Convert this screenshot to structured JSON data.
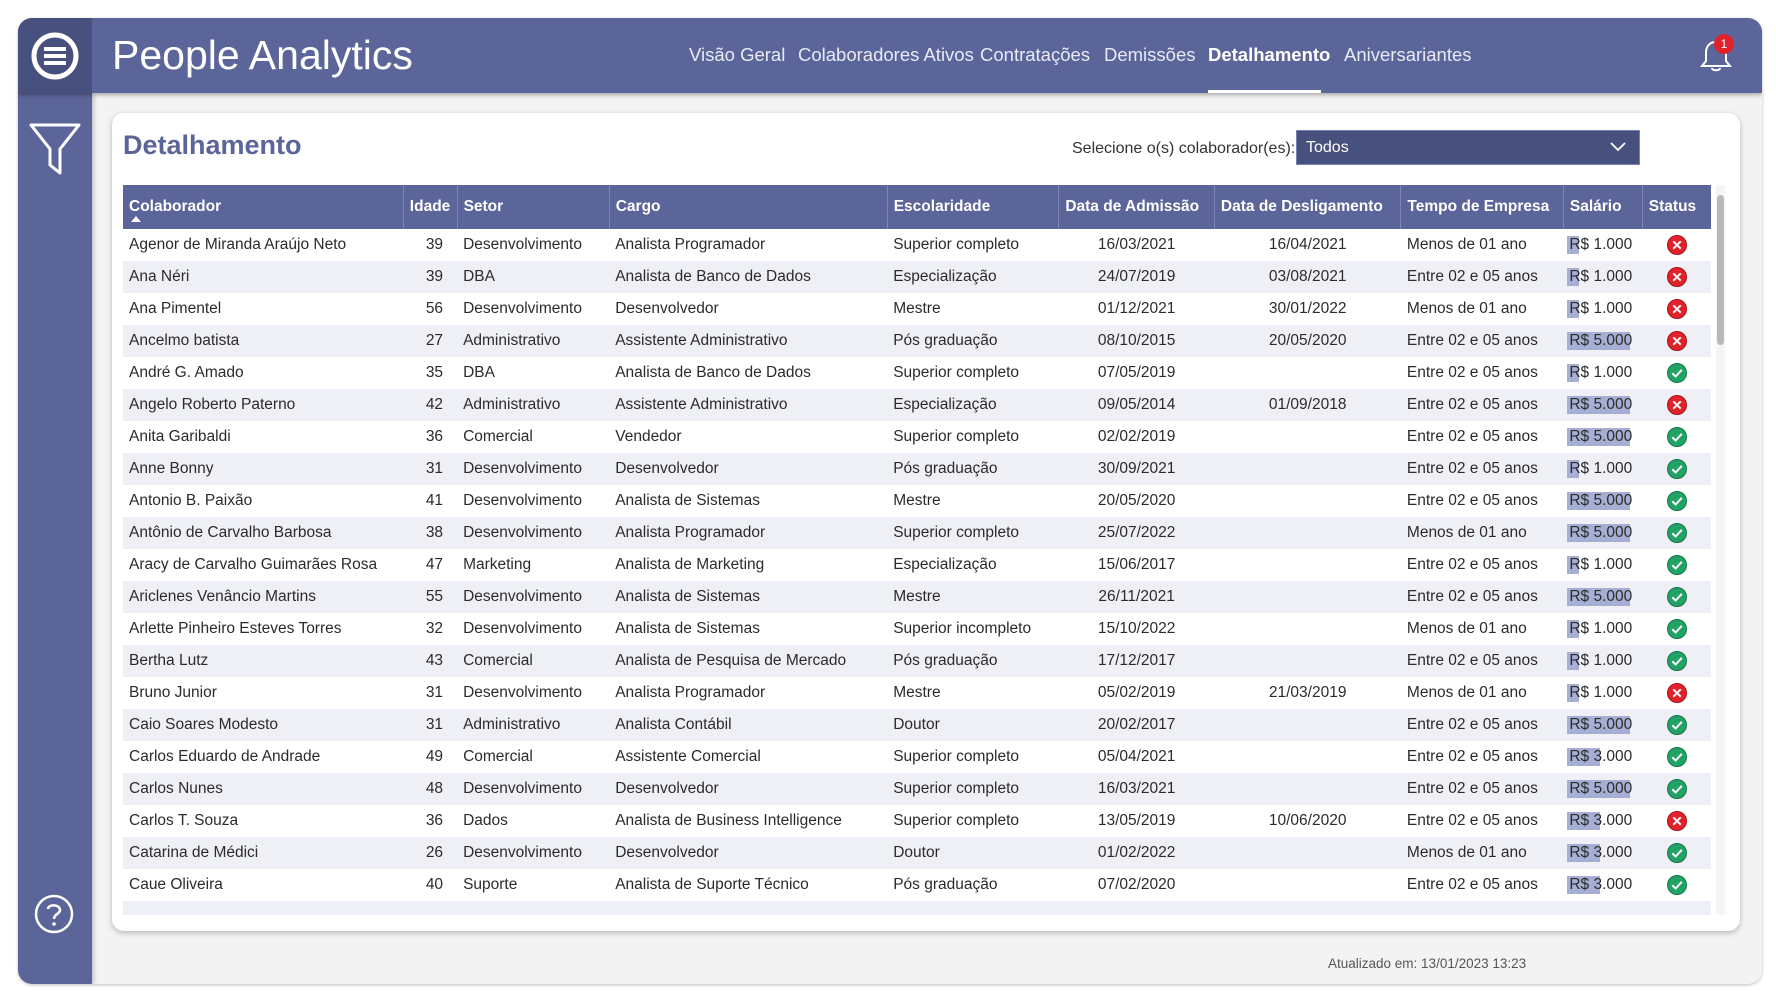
{
  "app": {
    "title": "People Analytics",
    "logo_icon": "hamburger-circle-logo"
  },
  "nav": {
    "items": [
      {
        "label": "Visão Geral",
        "active": false
      },
      {
        "label": "Colaboradores Ativos",
        "active": false
      },
      {
        "label": "Contratações",
        "active": false
      },
      {
        "label": "Demissões",
        "active": false
      },
      {
        "label": "Detalhamento",
        "active": true
      },
      {
        "label": "Aniversariantes",
        "active": false
      }
    ],
    "notifications": {
      "icon": "bell-icon",
      "count": "1"
    }
  },
  "sidebar": {
    "filter_icon": "filter-icon",
    "help_icon": "help-icon"
  },
  "page": {
    "title": "Detalhamento",
    "selector_label": "Selecione o(s) colaborador(es):",
    "selector_value": "Todos"
  },
  "table": {
    "columns": [
      "Colaborador",
      "Idade",
      "Setor",
      "Cargo",
      "Escolaridade",
      "Data de Admissão",
      "Data de Desligamento",
      "Tempo de Empresa",
      "Salário",
      "Status"
    ],
    "rows": [
      {
        "name": "Agenor de Miranda Araújo Neto",
        "age": "39",
        "sector": "Desenvolvimento",
        "role": "Analista Programador",
        "education": "Superior completo",
        "admission": "16/03/2021",
        "termination": "16/04/2021",
        "tenure": "Menos de 01 ano",
        "salary": "R$ 1.000",
        "salary_fraction": 0.04,
        "status": "desligado"
      },
      {
        "name": "Ana Néri",
        "age": "39",
        "sector": "DBA",
        "role": "Analista de Banco de Dados",
        "education": "Especialização",
        "admission": "24/07/2019",
        "termination": "03/08/2021",
        "tenure": "Entre 02 e 05 anos",
        "salary": "R$ 1.000",
        "salary_fraction": 0.04,
        "status": "desligado"
      },
      {
        "name": "Ana Pimentel",
        "age": "56",
        "sector": "Desenvolvimento",
        "role": "Desenvolvedor",
        "education": "Mestre",
        "admission": "01/12/2021",
        "termination": "30/01/2022",
        "tenure": "Menos de 01 ano",
        "salary": "R$ 1.000",
        "salary_fraction": 0.04,
        "status": "desligado"
      },
      {
        "name": "Ancelmo batista",
        "age": "27",
        "sector": "Administrativo",
        "role": "Assistente Administrativo",
        "education": "Pós graduação",
        "admission": "08/10/2015",
        "termination": "20/05/2020",
        "tenure": "Entre 02 e 05 anos",
        "salary": "R$ 5.000",
        "salary_fraction": 1.0,
        "status": "desligado"
      },
      {
        "name": "André G. Amado",
        "age": "35",
        "sector": "DBA",
        "role": "Analista de Banco de Dados",
        "education": "Superior completo",
        "admission": "07/05/2019",
        "termination": "",
        "tenure": "Entre 02 e 05 anos",
        "salary": "R$ 1.000",
        "salary_fraction": 0.04,
        "status": "ativo"
      },
      {
        "name": "Angelo Roberto Paterno",
        "age": "42",
        "sector": "Administrativo",
        "role": "Assistente Administrativo",
        "education": "Especialização",
        "admission": "09/05/2014",
        "termination": "01/09/2018",
        "tenure": "Entre 02 e 05 anos",
        "salary": "R$ 5.000",
        "salary_fraction": 1.0,
        "status": "desligado"
      },
      {
        "name": "Anita Garibaldi",
        "age": "36",
        "sector": "Comercial",
        "role": "Vendedor",
        "education": "Superior completo",
        "admission": "02/02/2019",
        "termination": "",
        "tenure": "Entre 02 e 05 anos",
        "salary": "R$ 5.000",
        "salary_fraction": 1.0,
        "status": "ativo"
      },
      {
        "name": "Anne Bonny",
        "age": "31",
        "sector": "Desenvolvimento",
        "role": "Desenvolvedor",
        "education": "Pós graduação",
        "admission": "30/09/2021",
        "termination": "",
        "tenure": "Entre 02 e 05 anos",
        "salary": "R$ 1.000",
        "salary_fraction": 0.04,
        "status": "ativo"
      },
      {
        "name": "Antonio B. Paixão",
        "age": "41",
        "sector": "Desenvolvimento",
        "role": "Analista de Sistemas",
        "education": "Mestre",
        "admission": "20/05/2020",
        "termination": "",
        "tenure": "Entre 02 e 05 anos",
        "salary": "R$ 5.000",
        "salary_fraction": 1.0,
        "status": "ativo"
      },
      {
        "name": "Antônio de Carvalho Barbosa",
        "age": "38",
        "sector": "Desenvolvimento",
        "role": "Analista Programador",
        "education": "Superior completo",
        "admission": "25/07/2022",
        "termination": "",
        "tenure": "Menos de 01 ano",
        "salary": "R$ 5.000",
        "salary_fraction": 1.0,
        "status": "ativo"
      },
      {
        "name": "Aracy de Carvalho Guimarães Rosa",
        "age": "47",
        "sector": "Marketing",
        "role": "Analista de Marketing",
        "education": "Especialização",
        "admission": "15/06/2017",
        "termination": "",
        "tenure": "Entre 02 e 05 anos",
        "salary": "R$ 1.000",
        "salary_fraction": 0.04,
        "status": "ativo"
      },
      {
        "name": "Ariclenes Venâncio Martins",
        "age": "55",
        "sector": "Desenvolvimento",
        "role": "Analista de Sistemas",
        "education": "Mestre",
        "admission": "26/11/2021",
        "termination": "",
        "tenure": "Entre 02 e 05 anos",
        "salary": "R$ 5.000",
        "salary_fraction": 1.0,
        "status": "ativo"
      },
      {
        "name": "Arlette Pinheiro Esteves Torres",
        "age": "32",
        "sector": "Desenvolvimento",
        "role": "Analista de Sistemas",
        "education": "Superior incompleto",
        "admission": "15/10/2022",
        "termination": "",
        "tenure": "Menos de 01 ano",
        "salary": "R$ 1.000",
        "salary_fraction": 0.04,
        "status": "ativo"
      },
      {
        "name": "Bertha Lutz",
        "age": "43",
        "sector": "Comercial",
        "role": "Analista de Pesquisa de Mercado",
        "education": "Pós graduação",
        "admission": "17/12/2017",
        "termination": "",
        "tenure": "Entre 02 e 05 anos",
        "salary": "R$ 1.000",
        "salary_fraction": 0.04,
        "status": "ativo"
      },
      {
        "name": "Bruno Junior",
        "age": "31",
        "sector": "Desenvolvimento",
        "role": "Analista Programador",
        "education": "Mestre",
        "admission": "05/02/2019",
        "termination": "21/03/2019",
        "tenure": "Menos de 01 ano",
        "salary": "R$ 1.000",
        "salary_fraction": 0.04,
        "status": "desligado"
      },
      {
        "name": "Caio Soares Modesto",
        "age": "31",
        "sector": "Administrativo",
        "role": "Analista Contábil",
        "education": "Doutor",
        "admission": "20/02/2017",
        "termination": "",
        "tenure": "Entre 02 e 05 anos",
        "salary": "R$ 5.000",
        "salary_fraction": 1.0,
        "status": "ativo"
      },
      {
        "name": "Carlos Eduardo de Andrade",
        "age": "49",
        "sector": "Comercial",
        "role": "Assistente Comercial",
        "education": "Superior completo",
        "admission": "05/04/2021",
        "termination": "",
        "tenure": "Entre 02 e 05 anos",
        "salary": "R$ 3.000",
        "salary_fraction": 0.52,
        "status": "ativo"
      },
      {
        "name": "Carlos Nunes",
        "age": "48",
        "sector": "Desenvolvimento",
        "role": "Desenvolvedor",
        "education": "Superior completo",
        "admission": "16/03/2021",
        "termination": "",
        "tenure": "Entre 02 e 05 anos",
        "salary": "R$ 5.000",
        "salary_fraction": 1.0,
        "status": "ativo"
      },
      {
        "name": "Carlos T. Souza",
        "age": "36",
        "sector": "Dados",
        "role": "Analista de Business Intelligence",
        "education": "Superior completo",
        "admission": "13/05/2019",
        "termination": "10/06/2020",
        "tenure": "Entre 02 e 05 anos",
        "salary": "R$ 3.000",
        "salary_fraction": 0.52,
        "status": "desligado"
      },
      {
        "name": "Catarina de Médici",
        "age": "26",
        "sector": "Desenvolvimento",
        "role": "Desenvolvedor",
        "education": "Doutor",
        "admission": "01/02/2022",
        "termination": "",
        "tenure": "Menos de 01 ano",
        "salary": "R$ 3.000",
        "salary_fraction": 0.52,
        "status": "ativo"
      },
      {
        "name": "Caue Oliveira",
        "age": "40",
        "sector": "Suporte",
        "role": "Analista de Suporte Técnico",
        "education": "Pós graduação",
        "admission": "07/02/2020",
        "termination": "",
        "tenure": "Entre 02 e 05 anos",
        "salary": "R$ 3.000",
        "salary_fraction": 0.52,
        "status": "ativo"
      }
    ]
  },
  "colors": {
    "brand": "#5c6599",
    "brand_dark": "#48507e",
    "salary_bar": "#a7aed3",
    "status_ok": "#21a366",
    "status_off": "#e2222a"
  },
  "footer": {
    "updated": "Atualizado em: 13/01/2023 13:23"
  }
}
